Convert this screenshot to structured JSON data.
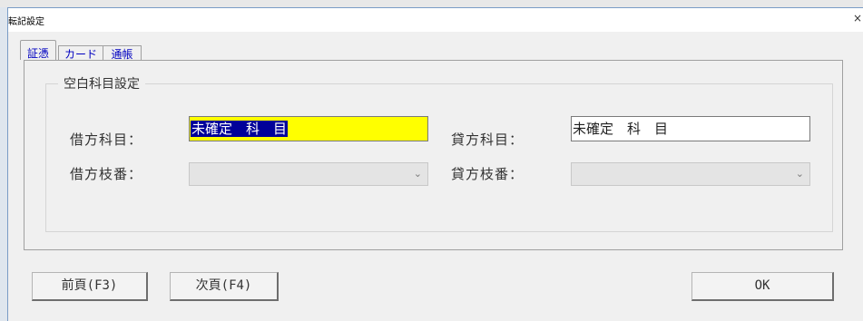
{
  "window": {
    "title": "転記設定",
    "close_glyph": "×"
  },
  "tabs": [
    {
      "label": "証憑",
      "active": true
    },
    {
      "label": "カード",
      "active": false
    },
    {
      "label": "通帳",
      "active": false
    }
  ],
  "group": {
    "legend": "空白科目設定",
    "debit_account_label": "借方科目：",
    "debit_account_value": "未確定　科　目",
    "credit_account_label": "貸方科目：",
    "credit_account_value": "未確定　科　目",
    "debit_branch_label": "借方枝番：",
    "debit_branch_value": "",
    "credit_branch_label": "貸方枝番：",
    "credit_branch_value": ""
  },
  "buttons": {
    "prev": "前頁(F3)",
    "next": "次頁(F4)",
    "ok": "OK"
  },
  "icons": {
    "dropdown": "chevron-down-icon",
    "close": "close-icon"
  },
  "colors": {
    "active_field_bg": "#ffff00",
    "selection_bg": "#000099",
    "tab_text": "#0000c0"
  }
}
